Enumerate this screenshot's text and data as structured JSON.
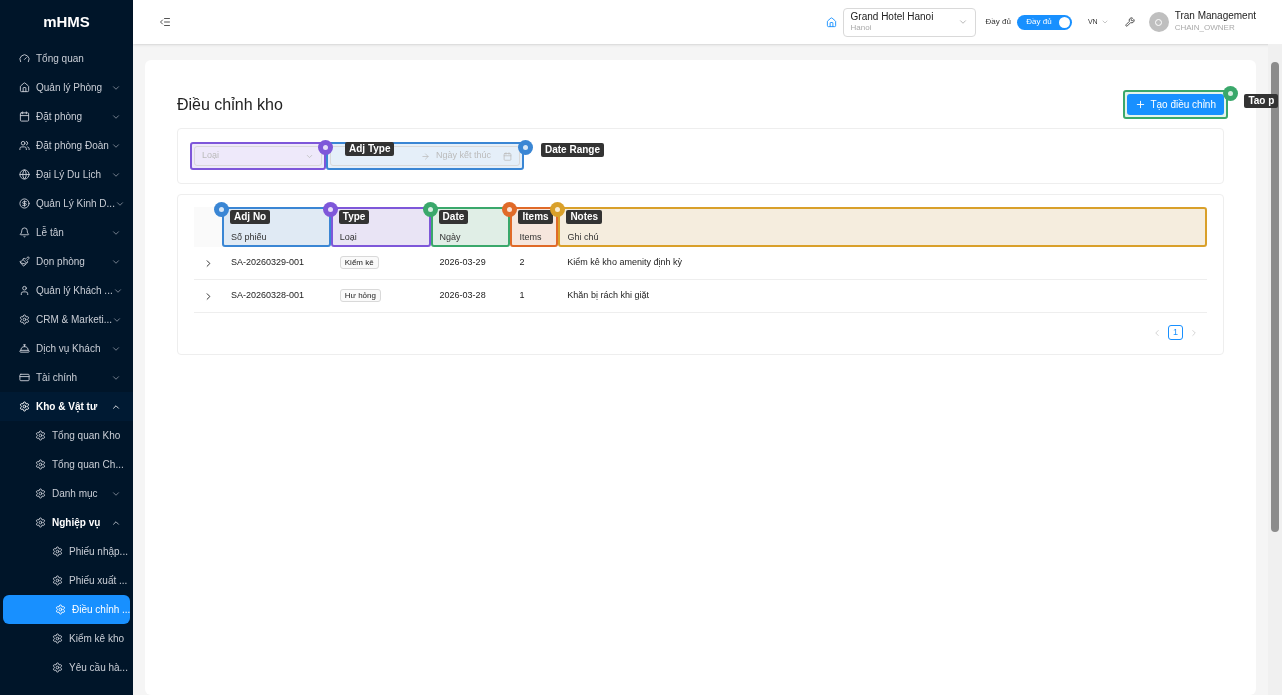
{
  "brand": "mHMS",
  "sidebar": {
    "items": [
      {
        "label": "Tổng quan",
        "selected": false
      },
      {
        "label": "Quản lý Phòng",
        "selected": false,
        "expanded": false
      },
      {
        "label": "Đặt phòng",
        "selected": false,
        "expanded": false
      },
      {
        "label": "Đặt phòng Đoàn",
        "selected": false,
        "expanded": false
      },
      {
        "label": "Đại Lý Du Lịch",
        "selected": false,
        "expanded": false
      },
      {
        "label": "Quản Lý Kinh D...",
        "selected": false,
        "expanded": false
      },
      {
        "label": "Lễ tân",
        "selected": false,
        "expanded": false
      },
      {
        "label": "Dọn phòng",
        "selected": false,
        "expanded": false
      },
      {
        "label": "Quản lý Khách ...",
        "selected": false,
        "expanded": false
      },
      {
        "label": "CRM & Marketi...",
        "selected": false,
        "expanded": false
      },
      {
        "label": "Dịch vụ Khách",
        "selected": false,
        "expanded": false
      },
      {
        "label": "Tài chính",
        "selected": false,
        "expanded": false
      },
      {
        "label": "Kho & Vật tư",
        "selected": false,
        "expanded": true,
        "children": [
          {
            "label": "Tổng quan Kho",
            "selected": false
          },
          {
            "label": "Tổng quan Ch...",
            "selected": false
          },
          {
            "label": "Danh mục",
            "selected": false,
            "expanded": false
          },
          {
            "label": "Nghiệp vụ",
            "selected": false,
            "expanded": true,
            "children": [
              {
                "label": "Phiếu nhập...",
                "selected": false
              },
              {
                "label": "Phiếu xuất ...",
                "selected": false
              },
              {
                "label": "Điều chỉnh ...",
                "selected": true
              },
              {
                "label": "Kiểm kê kho",
                "selected": false
              },
              {
                "label": "Yêu cầu hà...",
                "selected": false
              }
            ]
          }
        ]
      }
    ]
  },
  "header": {
    "hotel": {
      "name": "Grand Hotel Hanoi",
      "city": "Hanoi"
    },
    "mode_label": "Đầy đủ",
    "mode_toggle": {
      "text": "Đầy đủ",
      "on": true
    },
    "language": "VN",
    "user": {
      "name": "Tran Management",
      "role": "CHAIN_OWNER"
    }
  },
  "page": {
    "title": "Điều chỉnh kho",
    "create_button": {
      "label": "Tạo điều chỉnh",
      "tag": "Tao p",
      "color": "#3aa86b"
    },
    "filters": {
      "type_select": {
        "placeholder": "Loại",
        "tag": "Adj Type",
        "color": "#7e57d9"
      },
      "date_range": {
        "end_placeholder": "Ngày kết thúc",
        "tag": "Date Range",
        "color": "#3a86d4"
      }
    },
    "table": {
      "columns": [
        {
          "label": "Số phiếu",
          "tag": "Adj No",
          "color": "#3a86d4"
        },
        {
          "label": "Loại",
          "tag": "Type",
          "color": "#7e57d9"
        },
        {
          "label": "Ngày",
          "tag": "Date",
          "color": "#3aa86b"
        },
        {
          "label": "Items",
          "tag": "Items",
          "color": "#e06a28"
        },
        {
          "label": "Ghi chú",
          "tag": "Notes",
          "color": "#d9a02a"
        }
      ],
      "rows": [
        {
          "expanded": false,
          "cells": [
            "SA-20260329-001",
            "Kiểm kê",
            "2026-03-29",
            "2",
            "Kiểm kê kho amenity định kỳ"
          ]
        },
        {
          "expanded": false,
          "cells": [
            "SA-20260328-001",
            "Hư hỏng",
            "2026-03-28",
            "1",
            "Khăn bị rách khi giặt"
          ]
        }
      ]
    },
    "pagination": {
      "pages": [
        {
          "label": "1",
          "selected": true
        }
      ]
    }
  }
}
